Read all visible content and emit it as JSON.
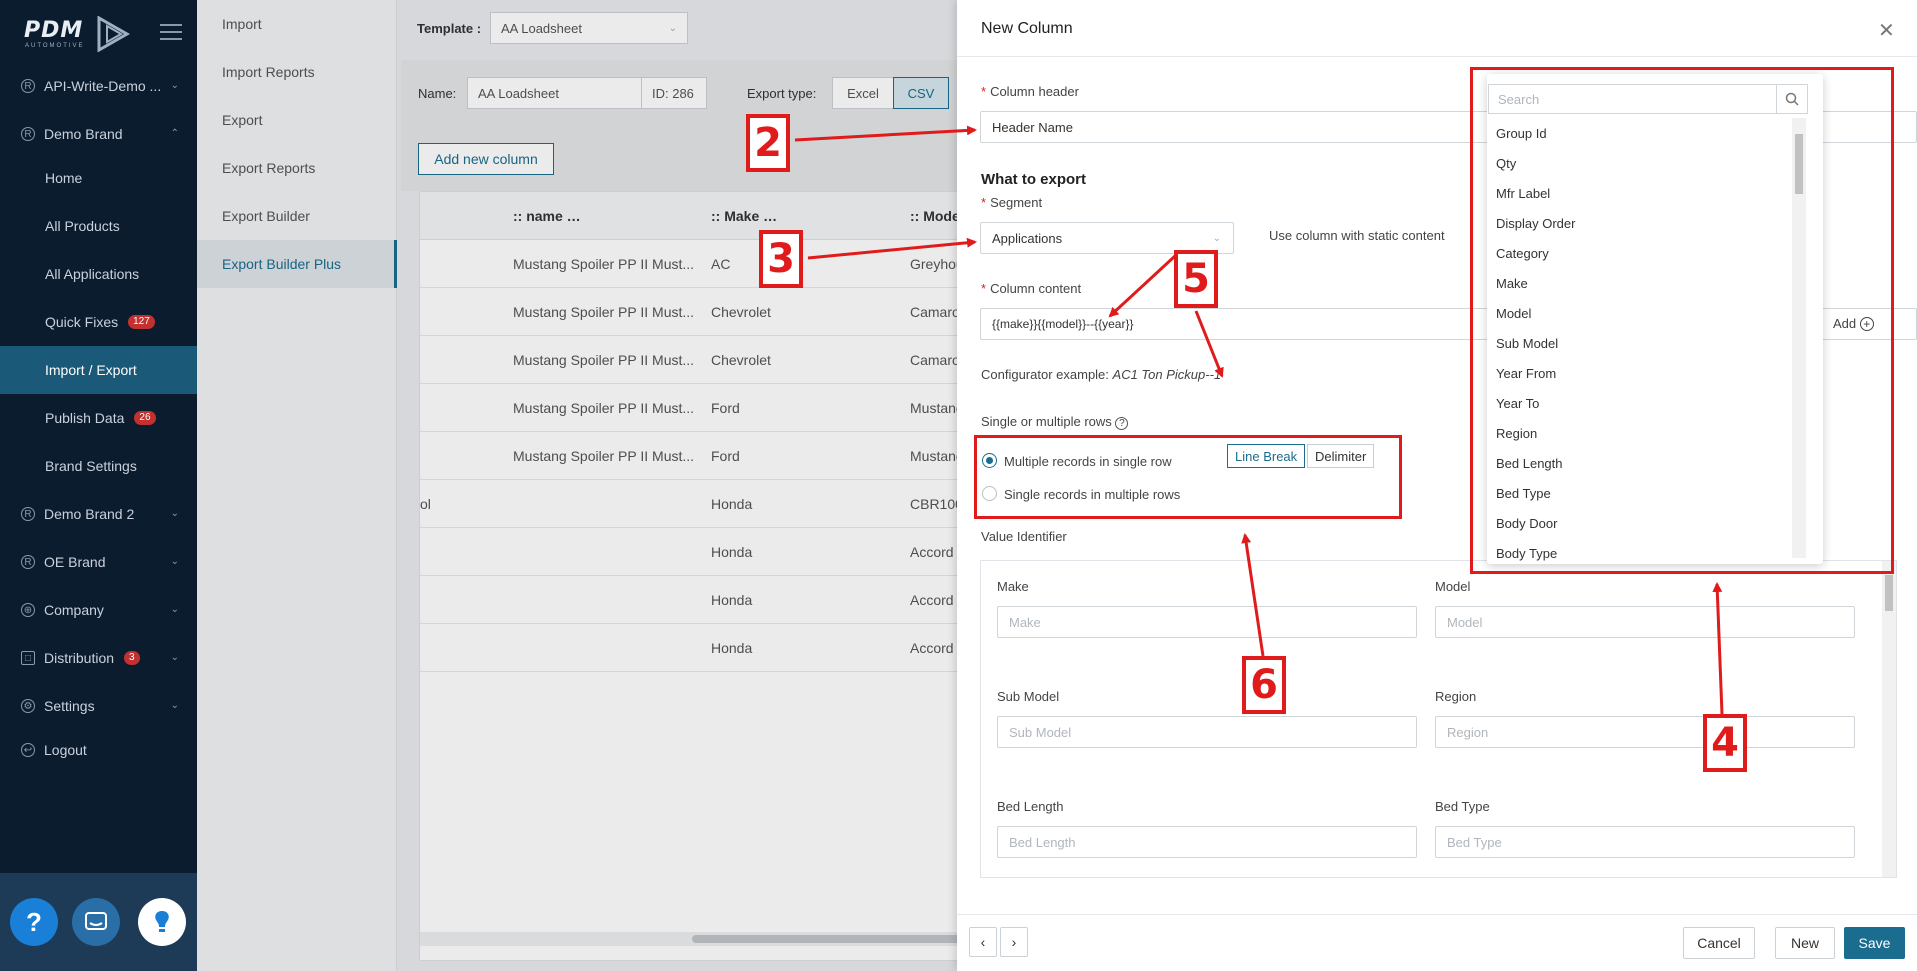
{
  "sidebar": {
    "logo": "PDM",
    "logo_sub": "AUTOMOTIVE",
    "items": [
      {
        "label": "API-Write-Demo ...",
        "icon": "registered-icon"
      },
      {
        "label": "Demo Brand",
        "icon": "registered-icon"
      },
      {
        "label": "Demo Brand 2",
        "icon": "registered-icon"
      },
      {
        "label": "OE Brand",
        "icon": "registered-icon"
      },
      {
        "label": "Company",
        "icon": "globe-icon"
      },
      {
        "label": "Distribution",
        "icon": "box-icon",
        "badge": "3"
      },
      {
        "label": "Settings",
        "icon": "gear-icon"
      },
      {
        "label": "Logout",
        "icon": "logout-icon"
      }
    ],
    "sub_items": [
      {
        "label": "Home"
      },
      {
        "label": "All Products"
      },
      {
        "label": "All Applications"
      },
      {
        "label": "Quick Fixes",
        "badge": "127"
      },
      {
        "label": "Import / Export"
      },
      {
        "label": "Publish Data",
        "badge": "26"
      },
      {
        "label": "Brand Settings"
      }
    ]
  },
  "subnav": {
    "items": [
      "Import",
      "Import Reports",
      "Export",
      "Export Reports",
      "Export Builder",
      "Export Builder Plus"
    ]
  },
  "main": {
    "template_label": "Template :",
    "template_value": "AA Loadsheet",
    "name_label": "Name:",
    "name_value": "AA Loadsheet",
    "id_value": "ID: 286",
    "export_type_label": "Export type:",
    "export_excel": "Excel",
    "export_csv": "CSV",
    "add_column": "Add new column",
    "columns": [
      ":: name …",
      ":: Make …",
      ":: Mode"
    ],
    "rows": [
      [
        "Mustang Spoiler PP II Must...",
        "AC",
        "Greyhou"
      ],
      [
        "Mustang Spoiler PP II Must...",
        "Chevrolet",
        "Camaro"
      ],
      [
        "Mustang Spoiler PP II Must...",
        "Chevrolet",
        "Camaro"
      ],
      [
        "Mustang Spoiler PP II Must...",
        "Ford",
        "Mustang"
      ],
      [
        "Mustang Spoiler PP II Must...",
        "Ford",
        "Mustang"
      ],
      [
        "ol",
        "Honda",
        "CBR100"
      ],
      [
        "",
        "Honda",
        "Accord"
      ],
      [
        "",
        "Honda",
        "Accord"
      ],
      [
        "",
        "Honda",
        "Accord"
      ]
    ]
  },
  "drawer": {
    "title": "New Column",
    "column_header_label": "Column header",
    "column_header_value": "Header Name",
    "what_to_export": "What to export",
    "segment_label": "Segment",
    "segment_value": "Applications",
    "static_label": "Use column with static content",
    "content_label": "Column content",
    "content_value": "{{make}}{{model}}--{{year}}",
    "add_label": "Add",
    "config_prefix": "Configurator example:",
    "config_example": "AC1 Ton Pickup--1",
    "rows_label": "Single or multiple rows",
    "option_multiple": "Multiple records in single row",
    "option_single": "Single records in multiple rows",
    "line_break": "Line Break",
    "delimiter": "Delimiter",
    "value_identifier": "Value Identifier",
    "vi_fields": [
      {
        "label": "Make",
        "placeholder": "Make"
      },
      {
        "label": "Model",
        "placeholder": "Model"
      },
      {
        "label": "Sub Model",
        "placeholder": "Sub Model"
      },
      {
        "label": "Region",
        "placeholder": "Region"
      },
      {
        "label": "Bed Length",
        "placeholder": "Bed Length"
      },
      {
        "label": "Bed Type",
        "placeholder": "Bed Type"
      }
    ],
    "cancel": "Cancel",
    "new": "New",
    "save": "Save"
  },
  "dropdown": {
    "search_placeholder": "Search",
    "items": [
      "Group Id",
      "Qty",
      "Mfr Label",
      "Display Order",
      "Category",
      "Make",
      "Model",
      "Sub Model",
      "Year From",
      "Year To",
      "Region",
      "Bed Length",
      "Bed Type",
      "Body Door",
      "Body Type"
    ]
  },
  "callouts": [
    "2",
    "3",
    "5",
    "6",
    "4"
  ],
  "colors": {
    "accent": "#1a6d8f",
    "annotation": "#e01b1b",
    "sidebar": "#0c1c2f"
  }
}
